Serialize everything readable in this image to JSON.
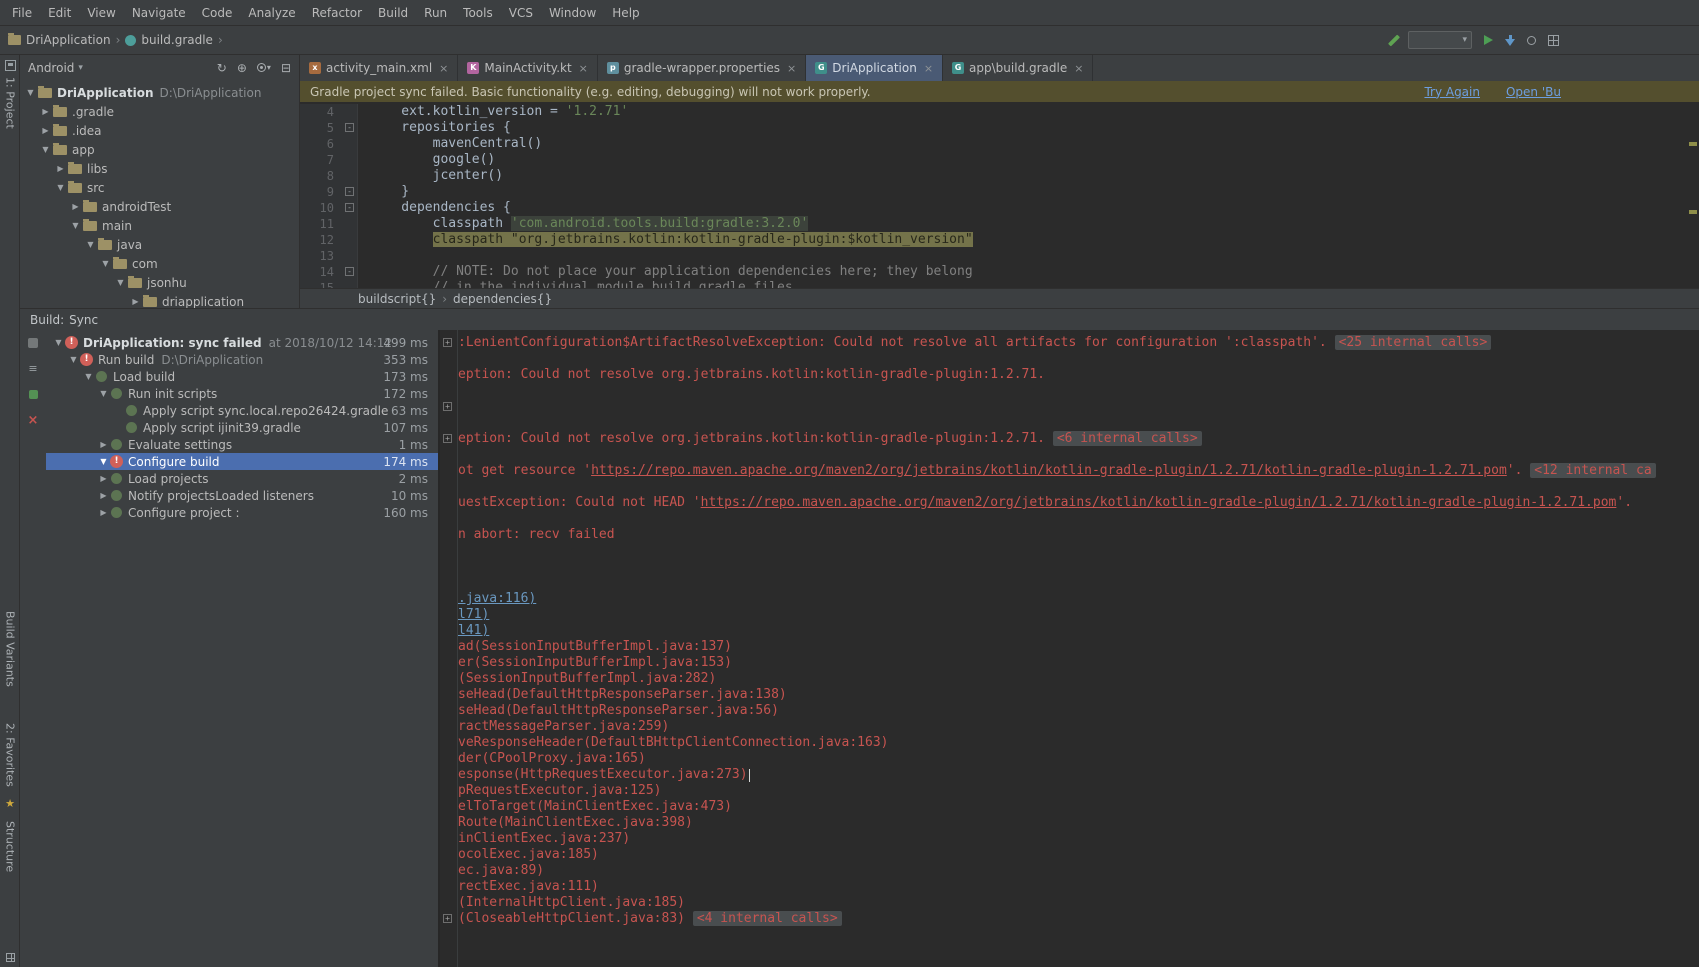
{
  "colors": {
    "accent_selection": "#4b6eaf",
    "error_red": "#c75450",
    "banner_bg": "#544f2e",
    "link_blue": "#6d9ee0",
    "editor_bg": "#2b2b2b",
    "panel_bg": "#3c3f41"
  },
  "window": {
    "menubar": [
      "File",
      "Edit",
      "View",
      "Navigate",
      "Code",
      "Analyze",
      "Refactor",
      "Build",
      "Run",
      "Tools",
      "VCS",
      "Window",
      "Help"
    ],
    "breadcrumb": [
      "DriApplication",
      "build.gradle"
    ]
  },
  "left_strip": {
    "project": "1: Project",
    "build_variants": "Build Variants",
    "favorites": "2: Favorites",
    "structure": "Structure"
  },
  "project_panel": {
    "view_selector": "Android",
    "tree": [
      {
        "indent": 0,
        "arrow": "d",
        "label": "DriApplication",
        "suffix": "D:\\DriApplication",
        "bold": true
      },
      {
        "indent": 1,
        "arrow": "r",
        "label": ".gradle"
      },
      {
        "indent": 1,
        "arrow": "r",
        "label": ".idea"
      },
      {
        "indent": 1,
        "arrow": "d",
        "label": "app"
      },
      {
        "indent": 2,
        "arrow": "r",
        "label": "libs"
      },
      {
        "indent": 2,
        "arrow": "d",
        "label": "src"
      },
      {
        "indent": 3,
        "arrow": "r",
        "label": "androidTest"
      },
      {
        "indent": 3,
        "arrow": "d",
        "label": "main"
      },
      {
        "indent": 4,
        "arrow": "d",
        "label": "java"
      },
      {
        "indent": 5,
        "arrow": "d",
        "label": "com"
      },
      {
        "indent": 6,
        "arrow": "d",
        "label": "jsonhu"
      },
      {
        "indent": 7,
        "arrow": "r",
        "label": "driapplication"
      }
    ]
  },
  "editor": {
    "tabs": [
      {
        "label": "activity_main.xml",
        "type": "xml",
        "active": false
      },
      {
        "label": "MainActivity.kt",
        "type": "kotlin",
        "active": false
      },
      {
        "label": "gradle-wrapper.properties",
        "type": "properties",
        "active": false
      },
      {
        "label": "DriApplication",
        "type": "gradle",
        "active": true
      },
      {
        "label": "app\\build.gradle",
        "type": "gradle",
        "active": false
      }
    ],
    "banner": {
      "message": "Gradle project sync failed. Basic functionality (e.g. editing, debugging) will not work properly.",
      "actions": [
        "Try Again",
        "Open 'Bu"
      ]
    },
    "code_lines": [
      {
        "n": 4,
        "fold": "",
        "spans": [
          [
            "p",
            "    ext.kotlin_version = "
          ],
          [
            "s",
            "'1.2.71'"
          ]
        ]
      },
      {
        "n": 5,
        "fold": "-",
        "spans": [
          [
            "p",
            "    repositories {"
          ]
        ]
      },
      {
        "n": 6,
        "fold": "",
        "spans": [
          [
            "p",
            "        mavenCentral()"
          ]
        ]
      },
      {
        "n": 7,
        "fold": "",
        "spans": [
          [
            "p",
            "        google()"
          ]
        ]
      },
      {
        "n": 8,
        "fold": "",
        "spans": [
          [
            "p",
            "        jcenter()"
          ]
        ]
      },
      {
        "n": 9,
        "fold": "-",
        "spans": [
          [
            "p",
            "    }"
          ]
        ]
      },
      {
        "n": 10,
        "fold": "-",
        "spans": [
          [
            "p",
            "    dependencies {"
          ]
        ]
      },
      {
        "n": 11,
        "fold": "",
        "spans": [
          [
            "p",
            "        classpath "
          ],
          [
            "sb",
            "'com.android.tools.build:gradle:3.2.0'"
          ]
        ]
      },
      {
        "n": 12,
        "fold": "",
        "spans": [
          [
            "p",
            "        "
          ],
          [
            "hl",
            "classpath \"org.jetbrains.kotlin:kotlin-gradle-plugin:$kotlin_version\""
          ]
        ]
      },
      {
        "n": 13,
        "fold": "",
        "spans": []
      },
      {
        "n": 14,
        "fold": "-",
        "spans": [
          [
            "c",
            "        // NOTE: Do not place your application dependencies here; they belong"
          ]
        ]
      },
      {
        "n": 15,
        "fold": "",
        "spans": [
          [
            "c",
            "        // in the individual module build.gradle files"
          ]
        ]
      }
    ],
    "breadcrumbs": [
      "buildscript{}",
      "dependencies{}"
    ]
  },
  "build_panel": {
    "title": "Build:",
    "subtitle": "Sync",
    "tree": [
      {
        "indent": 0,
        "arrow": "d",
        "icon": "err",
        "label": "DriApplication: sync failed",
        "suffix": "at 2018/10/12 14:12",
        "time": "499 ms",
        "bold": true
      },
      {
        "indent": 1,
        "arrow": "d",
        "icon": "err",
        "label": "Run build",
        "suffix": "D:\\DriApplication",
        "time": "353 ms"
      },
      {
        "indent": 2,
        "arrow": "d",
        "icon": "task",
        "label": "Load build",
        "time": "173 ms"
      },
      {
        "indent": 3,
        "arrow": "d",
        "icon": "task",
        "label": "Run init scripts",
        "time": "172 ms"
      },
      {
        "indent": 4,
        "arrow": "",
        "icon": "task",
        "label": "Apply script sync.local.repo26424.gradle",
        "time": "63 ms"
      },
      {
        "indent": 4,
        "arrow": "",
        "icon": "task",
        "label": "Apply script ijinit39.gradle",
        "time": "107 ms"
      },
      {
        "indent": 3,
        "arrow": "r",
        "icon": "task",
        "label": "Evaluate settings",
        "time": "1 ms"
      },
      {
        "indent": 3,
        "arrow": "d",
        "icon": "err",
        "label": "Configure build",
        "time": "174 ms",
        "selected": true
      },
      {
        "indent": 3,
        "arrow": "r",
        "icon": "task",
        "label": "Load projects",
        "time": "2 ms"
      },
      {
        "indent": 3,
        "arrow": "r",
        "icon": "task",
        "label": "Notify projectsLoaded listeners",
        "time": "10 ms"
      },
      {
        "indent": 3,
        "arrow": "r",
        "icon": "task",
        "label": "Configure project :",
        "time": "160 ms"
      }
    ],
    "console": [
      {
        "fold": true,
        "s": [
          [
            "err",
            ":LenientConfiguration$ArtifactResolveException: Could not resolve all artifacts for configuration ':classpath'. "
          ],
          [
            "badge",
            "<25 internal calls>"
          ]
        ]
      },
      {
        "s": []
      },
      {
        "s": [
          [
            "err",
            "eption: Could not resolve org.jetbrains.kotlin:kotlin-gradle-plugin:1.2.71."
          ]
        ]
      },
      {
        "s": []
      },
      {
        "fold": true,
        "s": []
      },
      {
        "s": []
      },
      {
        "fold": true,
        "s": [
          [
            "err",
            "eption: Could not resolve org.jetbrains.kotlin:kotlin-gradle-plugin:1.2.71. "
          ],
          [
            "badge",
            "<6 internal calls>"
          ]
        ]
      },
      {
        "s": []
      },
      {
        "s": [
          [
            "err",
            "ot get resource '"
          ],
          [
            "link",
            "https://repo.maven.apache.org/maven2/org/jetbrains/kotlin/kotlin-gradle-plugin/1.2.71/kotlin-gradle-plugin-1.2.71.pom"
          ],
          [
            "err",
            "'. "
          ],
          [
            "badge",
            "<12 internal ca"
          ]
        ]
      },
      {
        "s": []
      },
      {
        "s": [
          [
            "err",
            "uestException: Could not HEAD '"
          ],
          [
            "link",
            "https://repo.maven.apache.org/maven2/org/jetbrains/kotlin/kotlin-gradle-plugin/1.2.71/kotlin-gradle-plugin-1.2.71.pom"
          ],
          [
            "err",
            "'."
          ]
        ]
      },
      {
        "s": []
      },
      {
        "s": [
          [
            "err",
            "n abort: recv failed"
          ]
        ]
      },
      {
        "s": []
      },
      {
        "s": []
      },
      {
        "s": []
      },
      {
        "s": [
          [
            "link2",
            ".java:116)"
          ]
        ]
      },
      {
        "s": [
          [
            "link2",
            "l71)"
          ]
        ]
      },
      {
        "s": [
          [
            "link2",
            "l41)"
          ]
        ]
      },
      {
        "s": [
          [
            "err",
            "ad(SessionInputBufferImpl.java:137)"
          ]
        ]
      },
      {
        "s": [
          [
            "err",
            "er(SessionInputBufferImpl.java:153)"
          ]
        ]
      },
      {
        "s": [
          [
            "err",
            "(SessionInputBufferImpl.java:282)"
          ]
        ]
      },
      {
        "s": [
          [
            "err",
            "seHead(DefaultHttpResponseParser.java:138)"
          ]
        ]
      },
      {
        "s": [
          [
            "err",
            "seHead(DefaultHttpResponseParser.java:56)"
          ]
        ]
      },
      {
        "s": [
          [
            "err",
            "ractMessageParser.java:259)"
          ]
        ]
      },
      {
        "s": [
          [
            "err",
            "veResponseHeader(DefaultBHttpClientConnection.java:163)"
          ]
        ]
      },
      {
        "s": [
          [
            "err",
            "der(CPoolProxy.java:165)"
          ]
        ]
      },
      {
        "caret": true,
        "s": [
          [
            "err",
            "esponse(HttpRequestExecutor.java:273)"
          ]
        ]
      },
      {
        "s": [
          [
            "err",
            "pRequestExecutor.java:125)"
          ]
        ]
      },
      {
        "s": [
          [
            "err",
            "elToTarget(MainClientExec.java:473)"
          ]
        ]
      },
      {
        "s": [
          [
            "err",
            "Route(MainClientExec.java:398)"
          ]
        ]
      },
      {
        "s": [
          [
            "err",
            "inClientExec.java:237)"
          ]
        ]
      },
      {
        "s": [
          [
            "err",
            "ocolExec.java:185)"
          ]
        ]
      },
      {
        "s": [
          [
            "err",
            "ec.java:89)"
          ]
        ]
      },
      {
        "s": [
          [
            "err",
            "rectExec.java:111)"
          ]
        ]
      },
      {
        "s": [
          [
            "err",
            "(InternalHttpClient.java:185)"
          ]
        ]
      },
      {
        "fold": true,
        "s": [
          [
            "err",
            "(CloseableHttpClient.java:83) "
          ],
          [
            "badge",
            "<4 internal calls>"
          ]
        ]
      }
    ]
  }
}
